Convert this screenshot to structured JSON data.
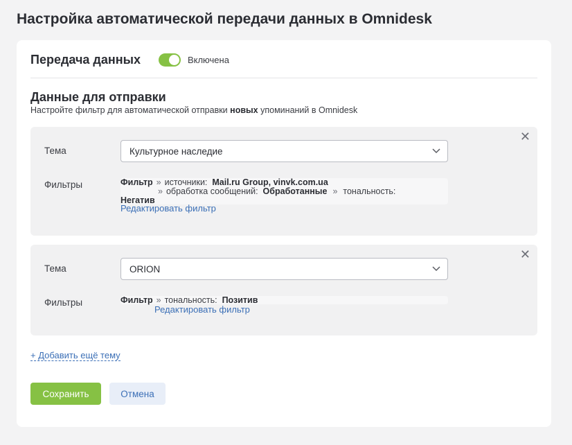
{
  "page": {
    "title": "Настройка автоматической передачи данных в Omnidesk"
  },
  "transfer": {
    "title": "Передача данных",
    "toggle_on": true,
    "toggle_label": "Включена"
  },
  "send_section": {
    "title": "Данные для отправки",
    "subtitle_pre": "Настройте фильтр для автоматической отправки ",
    "subtitle_bold": "новых",
    "subtitle_post": " упоминаний в Omnidesk"
  },
  "topics": [
    {
      "topic_label": "Тема",
      "topic_value": "Культурное наследие",
      "filters_label": "Фильтры",
      "filter_word": "Фильтр",
      "sources_label": "источники:",
      "sources_value": "Mail.ru Group, vinvk.com.ua",
      "processing_label": "обработка сообщений:",
      "processing_value": "Обработанные",
      "tonality_label": "тональность:",
      "tonality_value": "Негатив",
      "edit_label": "Редактировать фильтр"
    },
    {
      "topic_label": "Тема",
      "topic_value": "ORION",
      "filters_label": "Фильтры",
      "filter_word": "Фильтр",
      "tonality_label": "тональность:",
      "tonality_value": "Позитив",
      "edit_label": "Редактировать фильтр"
    }
  ],
  "glyphs": {
    "separator": "»",
    "close": "✕"
  },
  "actions": {
    "add_topic": "+ Добавить ещё тему",
    "save": "Сохранить",
    "cancel": "Отмена"
  },
  "colors": {
    "accent_green": "#86c144",
    "link_blue": "#3b6fb6",
    "panel_gray": "#f1f1f2"
  }
}
